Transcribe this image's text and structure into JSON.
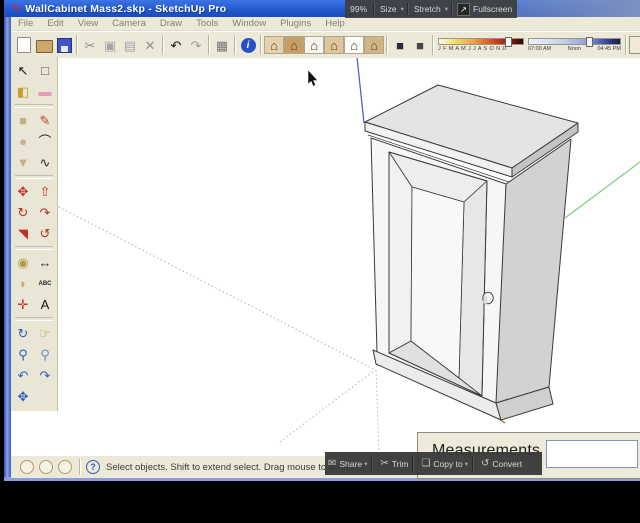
{
  "window": {
    "title": "WallCabinet Mass2.skp - SketchUp Pro"
  },
  "menu": {
    "items": [
      "File",
      "Edit",
      "View",
      "Camera",
      "Draw",
      "Tools",
      "Window",
      "Plugins",
      "Help"
    ]
  },
  "top_overlay": {
    "zoom_level": "99%",
    "size_label": "Size",
    "stretch_label": "Stretch",
    "fullscreen_label": "Fullscreen",
    "fullscreen_glyph": "↗",
    "caret_glyph": "▾"
  },
  "toolbar": {
    "items": [
      {
        "name": "new",
        "type": "page"
      },
      {
        "name": "open",
        "type": "folder"
      },
      {
        "name": "save",
        "type": "floppy"
      },
      {
        "sep": true
      },
      {
        "name": "cut",
        "glyph": "✂",
        "color": "#8f8f8f"
      },
      {
        "name": "copy",
        "glyph": "▣",
        "color": "#a6a6a6"
      },
      {
        "name": "paste",
        "glyph": "▤",
        "color": "#a6a6a6"
      },
      {
        "name": "erase",
        "glyph": "✕",
        "color": "#8f8f8f"
      },
      {
        "sep": true
      },
      {
        "name": "undo",
        "glyph": "↶",
        "color": "#161616"
      },
      {
        "name": "redo",
        "glyph": "↷",
        "color": "#9e9e9e"
      },
      {
        "sep": true
      },
      {
        "name": "print",
        "glyph": "▦",
        "color": "#767676"
      },
      {
        "sep": true
      },
      {
        "name": "help",
        "glyph": "i",
        "color": "#ffffff",
        "bg": "#2a50c8",
        "round": true
      },
      {
        "sep": true
      },
      {
        "name": "view-iso",
        "glyph": "⌂",
        "color": "#56431f",
        "bg": "#e4d2ae",
        "house": true
      },
      {
        "name": "view-top",
        "glyph": "⌂",
        "color": "#56431f",
        "bg": "#c99d66",
        "house": true
      },
      {
        "name": "view-front",
        "glyph": "⌂",
        "color": "#56431f",
        "bg": "#f7f5ef",
        "house": true
      },
      {
        "name": "view-right",
        "glyph": "⌂",
        "color": "#56431f",
        "bg": "#ddc59c",
        "house": true
      },
      {
        "name": "view-back",
        "glyph": "⌂",
        "color": "#56431f",
        "bg": "#fbfbf8",
        "house": true
      },
      {
        "name": "view-left",
        "glyph": "⌂",
        "color": "#56431f",
        "bg": "#d3b487",
        "house": true
      },
      {
        "sep": true
      },
      {
        "name": "shadow-settings",
        "glyph": "■",
        "color": "#2c2c34"
      },
      {
        "name": "shadow-toggle",
        "glyph": "■",
        "color": "#46464e"
      },
      {
        "sep": true
      }
    ]
  },
  "shadows": {
    "months": "J F M A M J J A S O N D",
    "time_start": "07:00 AM",
    "time_noon": "Noon",
    "time_end": "04:45 PM"
  },
  "palette": {
    "groups": [
      [
        {
          "name": "select",
          "glyph": "↖",
          "color": "#141414"
        },
        {
          "name": "make-component",
          "glyph": "□",
          "color": "#6a5a3a"
        },
        {
          "name": "paint-bucket",
          "glyph": "◧",
          "color": "#c59e2e"
        },
        {
          "name": "eraser",
          "glyph": "▬",
          "color": "#e39cb2"
        }
      ],
      [
        {
          "name": "rectangle",
          "glyph": "■",
          "color": "#c3b28a"
        },
        {
          "name": "line",
          "glyph": "✎",
          "color": "#c23b28"
        },
        {
          "name": "circle",
          "glyph": "●",
          "color": "#c3b28a"
        },
        {
          "name": "arc",
          "glyph": "⌒",
          "color": "#2a2a2a"
        },
        {
          "name": "polygon",
          "glyph": "▼",
          "color": "#c3b28a"
        },
        {
          "name": "freehand",
          "glyph": "∿",
          "color": "#2a2a2a"
        }
      ],
      [
        {
          "name": "move",
          "glyph": "✥",
          "color": "#c03028"
        },
        {
          "name": "push-pull",
          "glyph": "⇧",
          "color": "#c03028"
        },
        {
          "name": "rotate",
          "glyph": "↻",
          "color": "#c03028"
        },
        {
          "name": "follow-me",
          "glyph": "↷",
          "color": "#c03028"
        },
        {
          "name": "scale",
          "glyph": "◥",
          "color": "#c03028"
        },
        {
          "name": "offset",
          "glyph": "↺",
          "color": "#c03028"
        }
      ],
      [
        {
          "name": "tape-measure",
          "glyph": "◉",
          "color": "#b29a40"
        },
        {
          "name": "dimension",
          "glyph": "↔",
          "color": "#3a3a3a"
        },
        {
          "name": "protractor",
          "glyph": "◗",
          "color": "#c6ae66"
        },
        {
          "name": "text",
          "glyph": "ABC",
          "color": "#222222",
          "small": true
        },
        {
          "name": "axes",
          "glyph": "✛",
          "color": "#c03028"
        },
        {
          "name": "text-3d",
          "glyph": "A",
          "color": "#161616"
        }
      ],
      [
        {
          "name": "orbit",
          "glyph": "↻",
          "color": "#2d5fc0"
        },
        {
          "name": "pan",
          "glyph": "☞",
          "color": "#ad8e50"
        },
        {
          "name": "zoom",
          "glyph": "⚲",
          "color": "#2d5fc0"
        },
        {
          "name": "zoom-window",
          "glyph": "⚲",
          "color": "#6d86c8"
        },
        {
          "name": "zoom-previous",
          "glyph": "↶",
          "color": "#2d5fc0"
        },
        {
          "name": "zoom-next",
          "glyph": "↷",
          "color": "#2d5fc0"
        },
        {
          "name": "zoom-extents",
          "glyph": "✥",
          "color": "#2d5fc0"
        }
      ]
    ]
  },
  "status": {
    "help_glyph": "?",
    "message": "Select objects. Shift to extend select. Drag mouse to select m",
    "icons": [
      "geo-status-icon",
      "claim-model-icon",
      "sign-in-status-icon"
    ]
  },
  "measurements": {
    "label": "Measurements",
    "value": ""
  },
  "bottom_overlay": {
    "share_icon": "✉",
    "share": "Share",
    "trim_icon": "✂",
    "trim": "Trim",
    "copy_icon": "❏",
    "copy_to": "Copy to",
    "convert_icon": "↺",
    "convert": "Convert",
    "caret_glyph": "▾"
  },
  "colors": {
    "titlebar_blue": "#2257cc",
    "chrome_tan": "#ece9d8",
    "axis_blue": "#4a55d0",
    "axis_green": "#7ec87e",
    "axis_red": "#d04a3a",
    "overlay_gray": "#3e3e3e"
  }
}
